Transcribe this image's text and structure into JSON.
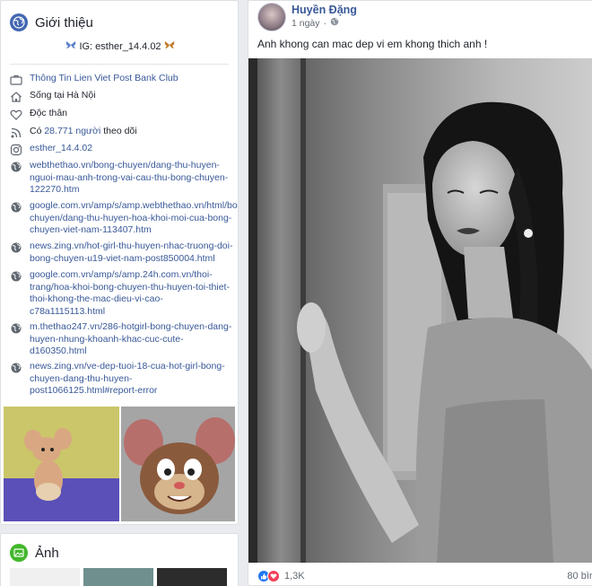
{
  "intro": {
    "title": "Giới thiệu",
    "bio": "IG: esther_14.4.02",
    "bio_prefix_emoji": "🦋",
    "bio_suffix_emoji": "🦋",
    "items": [
      {
        "icon": "briefcase-icon",
        "text": "Thông Tin Lien Viet Post Bank Club",
        "link": true
      },
      {
        "icon": "home-icon",
        "text": "Sống tại Hà Nội",
        "link": false
      },
      {
        "icon": "heart-icon",
        "text": "Độc thân",
        "link": false
      },
      {
        "icon": "rss-icon",
        "text_prefix": "Có ",
        "count": "28.771 người",
        "text_suffix": " theo dõi"
      },
      {
        "icon": "instagram-icon",
        "text": "esther_14.4.02",
        "link": true
      },
      {
        "icon": "globe-icon",
        "text": "webthethao.vn/bong-chuyen/dang-thu-huyen-nguoi-mau-anh-trong-vai-cau-thu-bong-chuyen-122270.htm",
        "link": true
      },
      {
        "icon": "globe-icon",
        "text": "google.com.vn/amp/s/amp.webthethao.vn/html/bong-chuyen/dang-thu-huyen-hoa-khoi-moi-cua-bong-chuyen-viet-nam-113407.htm",
        "link": true
      },
      {
        "icon": "globe-icon",
        "text": "news.zing.vn/hot-girl-thu-huyen-nhac-truong-doi-bong-chuyen-u19-viet-nam-post850004.html",
        "link": true
      },
      {
        "icon": "globe-icon",
        "text": "google.com.vn/amp/s/amp.24h.com.vn/thoi-trang/hoa-khoi-bong-chuyen-thu-huyen-toi-thiet-thoi-khong-the-mac-dieu-vi-cao-c78a1115113.html",
        "link": true
      },
      {
        "icon": "globe-icon",
        "text": "m.thethao247.vn/286-hotgirl-bong-chuyen-dang-huyen-nhung-khoanh-khac-cuc-cute-d160350.html",
        "link": true
      },
      {
        "icon": "globe-icon",
        "text": "news.zing.vn/ve-dep-tuoi-18-cua-hot-girl-bong-chuyen-dang-thu-huyen-post1066125.html#report-error",
        "link": true
      }
    ]
  },
  "photos": {
    "title": "Ảnh"
  },
  "post": {
    "author": "Huyền Đặng",
    "time": "1 ngày",
    "text": "Anh khong can mac dep vi em khong thich anh !",
    "reactions_count": "1,3K",
    "comments": "80 bìn"
  },
  "colors": {
    "link": "#385898",
    "accent": "#4267b2",
    "like": "#2078f4",
    "love": "#f33e58"
  }
}
